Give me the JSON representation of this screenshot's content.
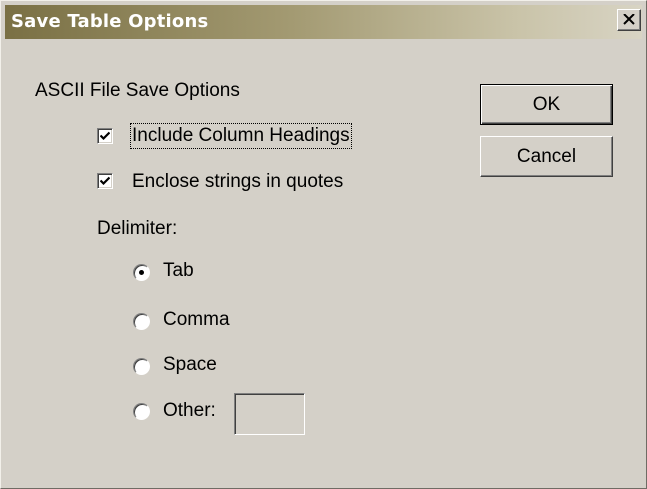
{
  "window": {
    "title": "Save Table Options"
  },
  "group": {
    "label": "ASCII File Save Options"
  },
  "options": {
    "include_headings": {
      "label": "Include Column Headings",
      "checked": true
    },
    "enclose_strings": {
      "label": "Enclose strings in quotes",
      "checked": true
    }
  },
  "delimiter": {
    "label": "Delimiter:",
    "selected": "Tab",
    "choices": [
      {
        "label": "Tab",
        "selected": true
      },
      {
        "label": "Comma",
        "selected": false
      },
      {
        "label": "Space",
        "selected": false
      },
      {
        "label": "Other:",
        "selected": false
      }
    ],
    "other_value": ""
  },
  "buttons": {
    "ok": "OK",
    "cancel": "Cancel"
  },
  "colors": {
    "dialog_background": "#d4d0c8",
    "titlebar_start": "#7a7044",
    "titlebar_end": "#d8d4c4"
  },
  "icons": {
    "close": "close-icon",
    "check": "checkmark-icon"
  }
}
